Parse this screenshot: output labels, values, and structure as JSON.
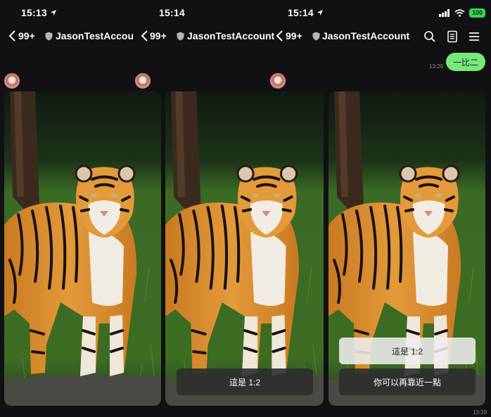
{
  "panels": [
    {
      "status_time": "15:13",
      "unread_count": "99+",
      "account_name": "JasonTestAccoun",
      "captions": []
    },
    {
      "status_time": "15:14",
      "unread_count": "99+",
      "account_name": "JasonTestAccount",
      "captions": [
        "這是 1:2"
      ]
    },
    {
      "status_time": "15:14",
      "unread_count": "99+",
      "account_name": "JasonTestAccount",
      "captions": [
        "這是 1:2",
        "你可以再靠近一點"
      ],
      "sent_message": "一比二",
      "sent_time": "13:29",
      "bottom_time": "13:29",
      "battery": "100"
    }
  ],
  "icons": {
    "back": "chevron-left-icon",
    "shield": "shield-icon",
    "search": "search-icon",
    "notes": "notes-icon",
    "menu": "menu-icon",
    "location": "location-arrow-icon",
    "signal": "signal-icon",
    "wifi": "wifi-icon"
  },
  "colors": {
    "background": "#111113",
    "sent_bubble": "#78e87a",
    "battery": "#37d657"
  }
}
